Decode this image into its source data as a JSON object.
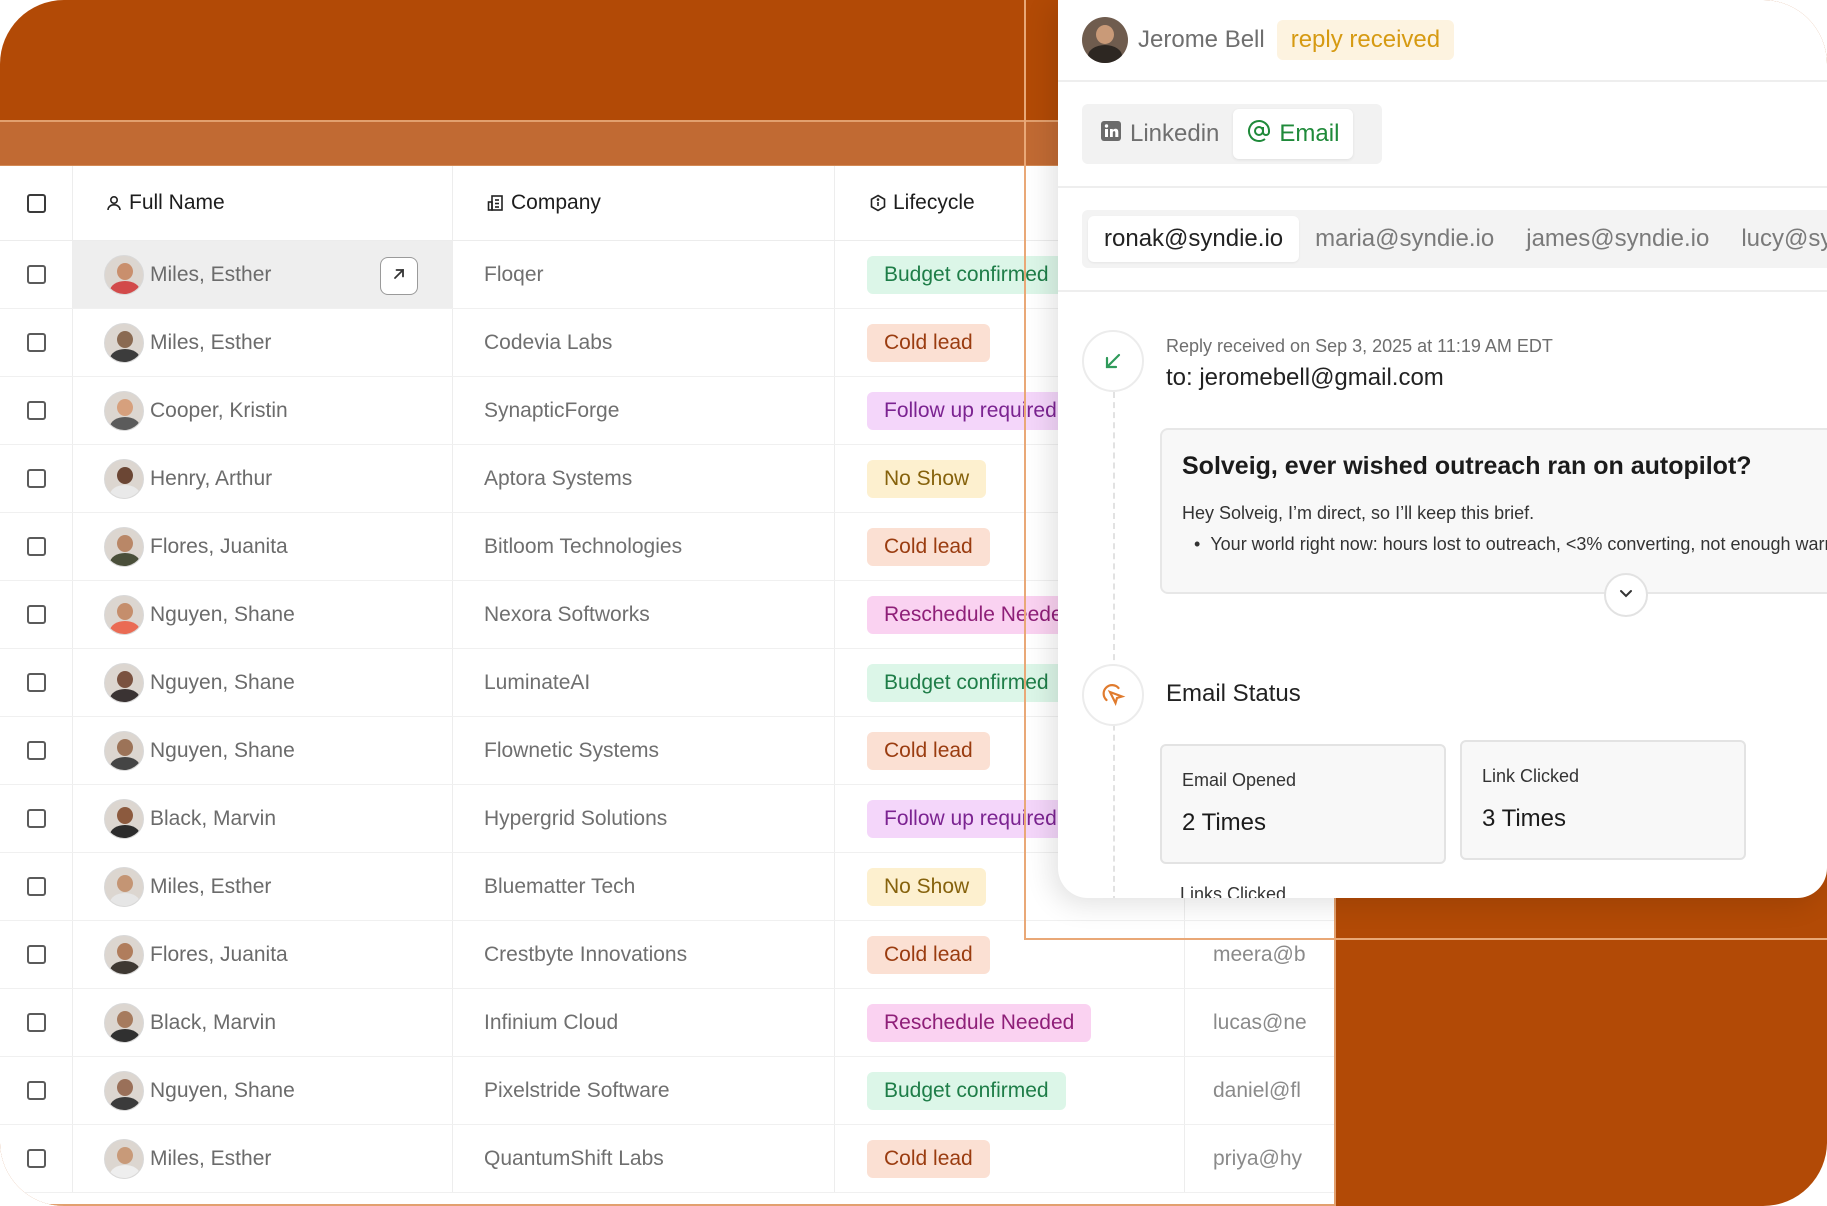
{
  "table": {
    "headers": {
      "full_name": "Full Name",
      "company": "Company",
      "lifecycle": "Lifecycle"
    },
    "rows": [
      {
        "name": "Miles, Esther",
        "company": "Floqer",
        "lifecycle": "Budget confirmed",
        "email": ""
      },
      {
        "name": "Miles, Esther",
        "company": "Codevia Labs",
        "lifecycle": "Cold lead",
        "email": ""
      },
      {
        "name": "Cooper, Kristin",
        "company": "SynapticForge",
        "lifecycle": "Follow up required",
        "email": ""
      },
      {
        "name": "Henry, Arthur",
        "company": "Aptora Systems",
        "lifecycle": "No Show",
        "email": ""
      },
      {
        "name": "Flores, Juanita",
        "company": "Bitloom Technologies",
        "lifecycle": "Cold lead",
        "email": ""
      },
      {
        "name": "Nguyen, Shane",
        "company": "Nexora Softworks",
        "lifecycle": "Reschedule Needed",
        "email": ""
      },
      {
        "name": "Nguyen, Shane",
        "company": "LuminateAI",
        "lifecycle": "Budget confirmed",
        "email": ""
      },
      {
        "name": "Nguyen, Shane",
        "company": "Flownetic Systems",
        "lifecycle": "Cold lead",
        "email": ""
      },
      {
        "name": "Black, Marvin",
        "company": "Hypergrid Solutions",
        "lifecycle": "Follow up required",
        "email": ""
      },
      {
        "name": "Miles, Esther",
        "company": "Bluematter Tech",
        "lifecycle": "No Show",
        "email": ""
      },
      {
        "name": "Flores, Juanita",
        "company": "Crestbyte Innovations",
        "lifecycle": "Cold lead",
        "email": "meera@b"
      },
      {
        "name": "Black, Marvin",
        "company": "Infinium Cloud",
        "lifecycle": "Reschedule Needed",
        "email": "lucas@ne"
      },
      {
        "name": "Nguyen, Shane",
        "company": "Pixelstride Software",
        "lifecycle": "Budget confirmed",
        "email": "daniel@fl"
      },
      {
        "name": "Miles, Esther",
        "company": "QuantumShift Labs",
        "lifecycle": "Cold lead",
        "email": "priya@hy"
      }
    ]
  },
  "badge_colors": {
    "Budget confirmed": {
      "bg": "#dcf6e8",
      "fg": "#1e7d48"
    },
    "Cold lead": {
      "bg": "#fbe0d3",
      "fg": "#9a3c10"
    },
    "Follow up required": {
      "bg": "#f4d6fa",
      "fg": "#7b2391"
    },
    "No Show": {
      "bg": "#fdf0cf",
      "fg": "#86620c"
    },
    "Reschedule Needed": {
      "bg": "#fad2f1",
      "fg": "#8e1f78"
    }
  },
  "panel": {
    "contact_name": "Jerome Bell",
    "status": "reply received",
    "channels": {
      "linkedin": "Linkedin",
      "email": "Email"
    },
    "addresses": [
      "ronak@syndie.io",
      "maria@syndie.io",
      "james@syndie.io",
      "lucy@syn"
    ],
    "reply_meta": "Reply received on Sep 3, 2025 at 11:19 AM EDT",
    "reply_to": "to: jeromebell@gmail.com",
    "email_subject": "Solveig, ever wished outreach ran on autopilot?",
    "email_body": "Hey Solveig, I’m direct, so I’ll keep this brief.",
    "email_bullet": "Your world right now: hours lost to outreach, <3% converting, not enough warm",
    "email_status_title": "Email Status",
    "stats": {
      "opened_label": "Email Opened",
      "opened_value": "2 Times",
      "clicked_label": "Link Clicked",
      "clicked_value": "3 Times"
    },
    "cut_label": "Links Clicked"
  },
  "colors": {
    "frame": "#b24a06",
    "accent_green": "#1f8a3a",
    "reply_pill": "#d69a12"
  }
}
